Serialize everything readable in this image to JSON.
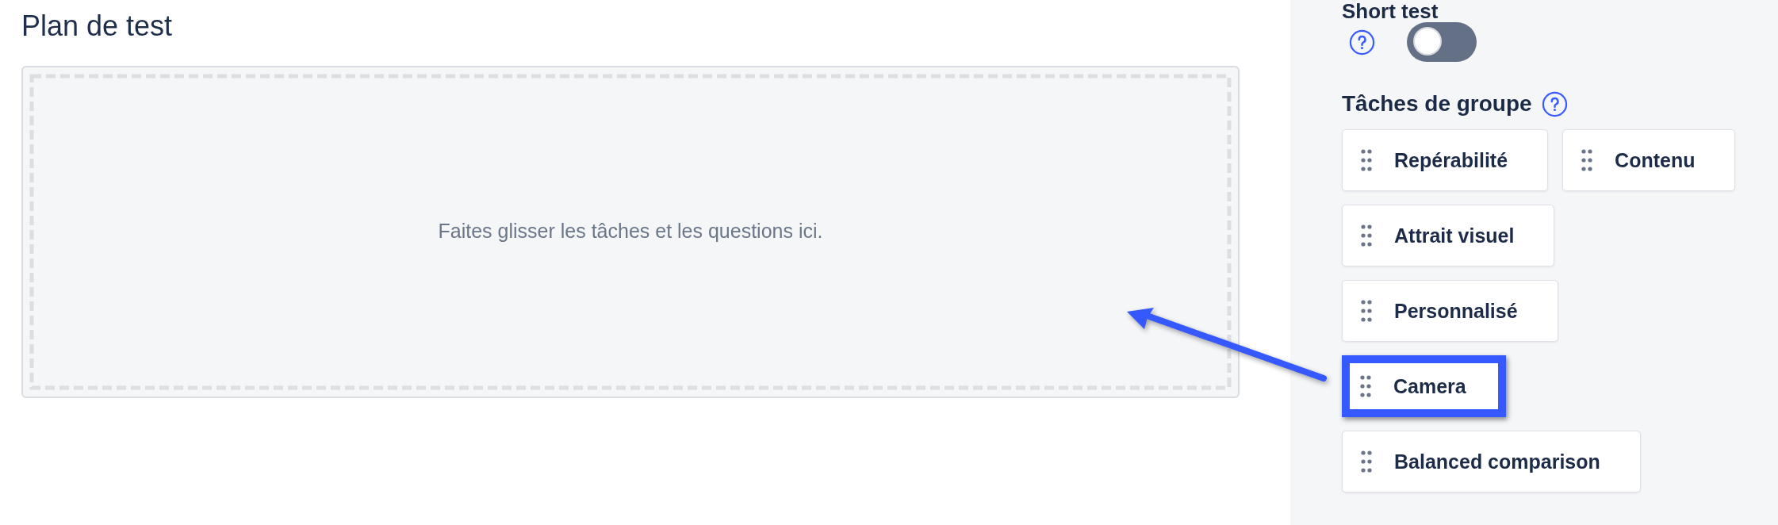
{
  "plan": {
    "title": "Plan de test",
    "drop_zone": {
      "hint": "Faites glisser les tâches et les questions ici."
    }
  },
  "sidebar": {
    "short_test": {
      "label": "Short test",
      "on": false
    },
    "group_tasks": {
      "heading": "Tâches de groupe",
      "rows": [
        {
          "tasks": [
            {
              "label": "Repérabilité",
              "highlighted": false
            },
            {
              "label": "Contenu",
              "highlighted": false
            }
          ]
        },
        {
          "tasks": [
            {
              "label": "Attrait visuel",
              "highlighted": false
            }
          ]
        },
        {
          "tasks": [
            {
              "label": "Personnalisé",
              "highlighted": false
            }
          ]
        },
        {
          "tasks": [
            {
              "label": "Camera",
              "highlighted": true
            }
          ]
        },
        {
          "tasks": [
            {
              "label": "Balanced comparison",
              "highlighted": false
            }
          ]
        }
      ]
    }
  }
}
